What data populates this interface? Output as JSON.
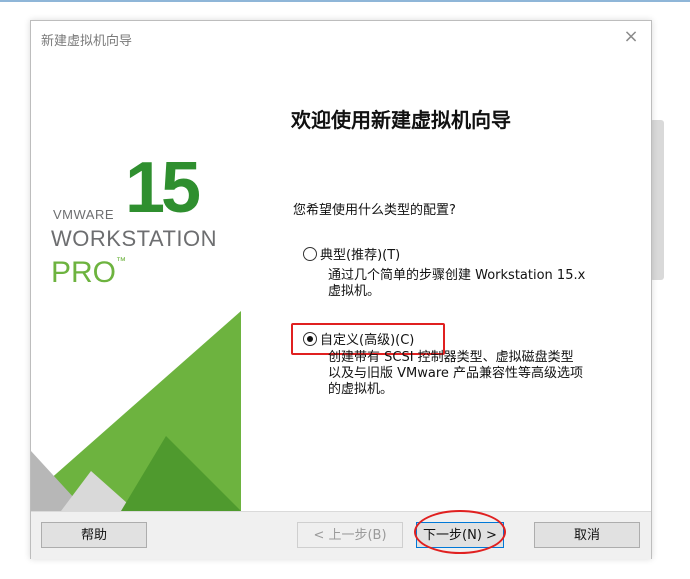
{
  "dialog": {
    "title": "新建虚拟机向导",
    "close_glyph": "×"
  },
  "brand": {
    "version": "15",
    "vendor": "VMWARE",
    "product": "WORKSTATION",
    "edition": "PRO",
    "trademark": "™",
    "accent_color": "#6db33f"
  },
  "content": {
    "heading": "欢迎使用新建虚拟机向导",
    "question": "您希望使用什么类型的配置?",
    "options": [
      {
        "label": "典型(推荐)(T)",
        "description_lines": [
          "通过几个简单的步骤创建 Workstation 15.x",
          "虚拟机。"
        ],
        "selected": false
      },
      {
        "label": "自定义(高级)(C)",
        "description_lines": [
          "创建带有 SCSI 控制器类型、虚拟磁盘类型",
          "以及与旧版 VMware 产品兼容性等高级选项",
          "的虚拟机。"
        ],
        "selected": true
      }
    ]
  },
  "footer": {
    "help": "帮助",
    "back": "< 上一步(B)",
    "next": "下一步(N) >",
    "cancel": "取消"
  },
  "annotation_color": "#e02020"
}
